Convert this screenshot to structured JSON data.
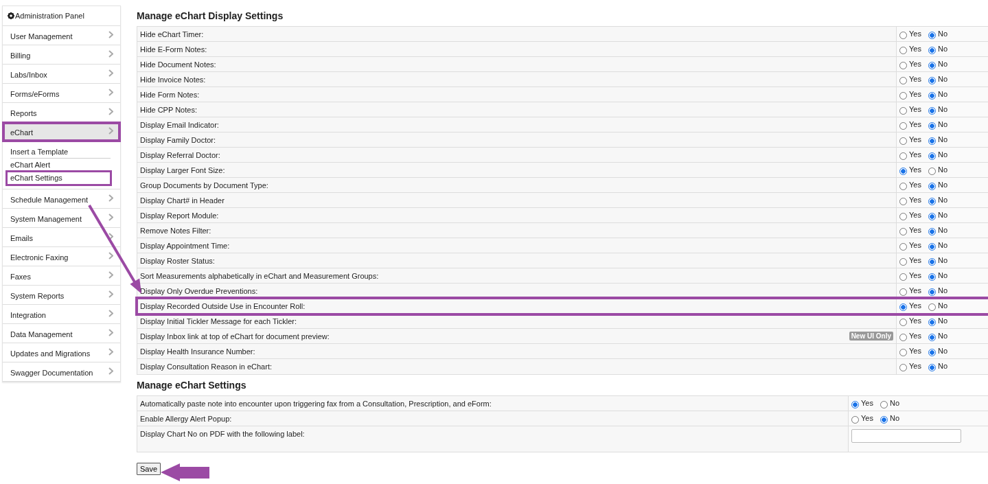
{
  "sidebar": {
    "title": "Administration Panel",
    "items": [
      {
        "label": "User Management",
        "highlighted": false
      },
      {
        "label": "Billing",
        "highlighted": false
      },
      {
        "label": "Labs/Inbox",
        "highlighted": false
      },
      {
        "label": "Forms/eForms",
        "highlighted": false
      },
      {
        "label": "Reports",
        "highlighted": false
      },
      {
        "label": "eChart",
        "highlighted": true,
        "selected": true,
        "children": [
          {
            "label": "Insert a Template",
            "highlighted": false
          },
          {
            "label": "eChart Alert",
            "highlighted": false
          },
          {
            "label": "eChart Settings",
            "highlighted": true
          }
        ]
      },
      {
        "label": "Schedule Management",
        "highlighted": false
      },
      {
        "label": "System Management",
        "highlighted": false
      },
      {
        "label": "Emails",
        "highlighted": false
      },
      {
        "label": "Electronic Faxing",
        "highlighted": false
      },
      {
        "label": "Faxes",
        "highlighted": false
      },
      {
        "label": "System Reports",
        "highlighted": false
      },
      {
        "label": "Integration",
        "highlighted": false
      },
      {
        "label": "Data Management",
        "highlighted": false
      },
      {
        "label": "Updates and Migrations",
        "highlighted": false
      },
      {
        "label": "Swagger Documentation",
        "highlighted": false
      }
    ]
  },
  "sections": [
    {
      "title": "Manage eChart Display Settings",
      "rows": [
        {
          "kind": "radio",
          "label": "Hide eChart Timer:",
          "options": [
            {
              "label": "Yes",
              "selected": false
            },
            {
              "label": "No",
              "selected": true
            }
          ]
        },
        {
          "kind": "radio",
          "label": "Hide E-Form Notes:",
          "options": [
            {
              "label": "Yes",
              "selected": false
            },
            {
              "label": "No",
              "selected": true
            }
          ]
        },
        {
          "kind": "radio",
          "label": "Hide Document Notes:",
          "options": [
            {
              "label": "Yes",
              "selected": false
            },
            {
              "label": "No",
              "selected": true
            }
          ]
        },
        {
          "kind": "radio",
          "label": "Hide Invoice Notes:",
          "options": [
            {
              "label": "Yes",
              "selected": false
            },
            {
              "label": "No",
              "selected": true
            }
          ]
        },
        {
          "kind": "radio",
          "label": "Hide Form Notes:",
          "options": [
            {
              "label": "Yes",
              "selected": false
            },
            {
              "label": "No",
              "selected": true
            }
          ]
        },
        {
          "kind": "radio",
          "label": "Hide CPP Notes:",
          "options": [
            {
              "label": "Yes",
              "selected": false
            },
            {
              "label": "No",
              "selected": true
            }
          ]
        },
        {
          "kind": "radio",
          "label": "Display Email Indicator:",
          "options": [
            {
              "label": "Yes",
              "selected": false
            },
            {
              "label": "No",
              "selected": true
            }
          ]
        },
        {
          "kind": "radio",
          "label": "Display Family Doctor:",
          "options": [
            {
              "label": "Yes",
              "selected": false
            },
            {
              "label": "No",
              "selected": true
            }
          ]
        },
        {
          "kind": "radio",
          "label": "Display Referral Doctor:",
          "options": [
            {
              "label": "Yes",
              "selected": false
            },
            {
              "label": "No",
              "selected": true
            }
          ]
        },
        {
          "kind": "radio",
          "label": "Display Larger Font Size:",
          "options": [
            {
              "label": "Yes",
              "selected": true
            },
            {
              "label": "No",
              "selected": false
            }
          ]
        },
        {
          "kind": "radio",
          "label": "Group Documents by Document Type:",
          "options": [
            {
              "label": "Yes",
              "selected": false
            },
            {
              "label": "No",
              "selected": true
            }
          ]
        },
        {
          "kind": "radio",
          "label": "Display Chart# in Header",
          "options": [
            {
              "label": "Yes",
              "selected": false
            },
            {
              "label": "No",
              "selected": true
            }
          ]
        },
        {
          "kind": "radio",
          "label": "Display Report Module:",
          "options": [
            {
              "label": "Yes",
              "selected": false
            },
            {
              "label": "No",
              "selected": true
            }
          ]
        },
        {
          "kind": "radio",
          "label": "Remove Notes Filter:",
          "options": [
            {
              "label": "Yes",
              "selected": false
            },
            {
              "label": "No",
              "selected": true
            }
          ]
        },
        {
          "kind": "radio",
          "label": "Display Appointment Time:",
          "options": [
            {
              "label": "Yes",
              "selected": false
            },
            {
              "label": "No",
              "selected": true
            }
          ]
        },
        {
          "kind": "radio",
          "label": "Display Roster Status:",
          "options": [
            {
              "label": "Yes",
              "selected": false
            },
            {
              "label": "No",
              "selected": true
            }
          ]
        },
        {
          "kind": "radio",
          "label": "Sort Measurements alphabetically in eChart and Measurement Groups:",
          "options": [
            {
              "label": "Yes",
              "selected": false
            },
            {
              "label": "No",
              "selected": true
            }
          ]
        },
        {
          "kind": "radio",
          "label": "Display Only Overdue Preventions:",
          "options": [
            {
              "label": "Yes",
              "selected": false
            },
            {
              "label": "No",
              "selected": true
            }
          ]
        },
        {
          "kind": "radio",
          "label": "Display Recorded Outside Use in Encounter Roll:",
          "highlighted": true,
          "options": [
            {
              "label": "Yes",
              "selected": true
            },
            {
              "label": "No",
              "selected": false
            }
          ]
        },
        {
          "kind": "radio",
          "label": "Display Initial Tickler Message for each Tickler:",
          "options": [
            {
              "label": "Yes",
              "selected": false
            },
            {
              "label": "No",
              "selected": true
            }
          ]
        },
        {
          "kind": "radio",
          "label": "Display Inbox link at top of eChart for document preview:",
          "badge": "New UI Only",
          "options": [
            {
              "label": "Yes",
              "selected": false
            },
            {
              "label": "No",
              "selected": true
            }
          ]
        },
        {
          "kind": "radio",
          "label": "Display Health Insurance Number:",
          "options": [
            {
              "label": "Yes",
              "selected": false
            },
            {
              "label": "No",
              "selected": true
            }
          ]
        },
        {
          "kind": "radio",
          "label": "Display Consultation Reason in eChart:",
          "options": [
            {
              "label": "Yes",
              "selected": false
            },
            {
              "label": "No",
              "selected": true
            }
          ]
        }
      ]
    },
    {
      "title": "Manage eChart Settings",
      "rows": [
        {
          "kind": "radio",
          "label": "Automatically paste note into encounter upon triggering fax from a Consultation, Prescription, and eForm:",
          "options": [
            {
              "label": "Yes",
              "selected": true
            },
            {
              "label": "No",
              "selected": false
            }
          ]
        },
        {
          "kind": "radio",
          "label": "Enable Allergy Alert Popup:",
          "options": [
            {
              "label": "Yes",
              "selected": false
            },
            {
              "label": "No",
              "selected": true
            }
          ]
        },
        {
          "kind": "text",
          "label": "Display Chart No on PDF with the following label:"
        }
      ]
    }
  ],
  "save_button": "Save"
}
